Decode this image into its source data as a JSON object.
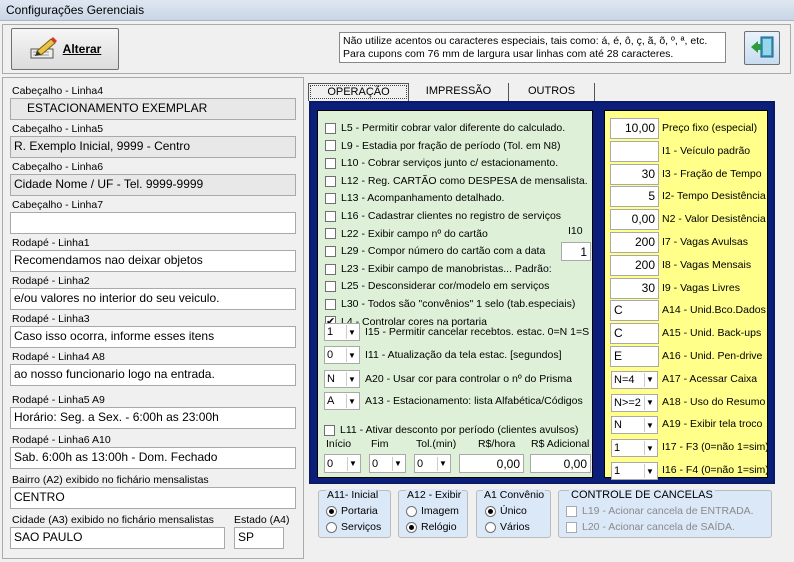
{
  "window": {
    "title": "Configurações Gerenciais"
  },
  "toolbar": {
    "alterar_label": "Alterar",
    "notice_line1": "Não utilize acentos ou caracteres  especiais, tais como: á, é, ô, ç, ã, õ, º, ª, etc.",
    "notice_line2": "Para cupons com 76 mm de largura usar linhas com até 28 caracteres."
  },
  "left": {
    "fields": [
      {
        "label": "Cabeçalho - Linha4",
        "value": "ESTACIONAMENTO EXEMPLAR"
      },
      {
        "label": "Cabeçalho - Linha5",
        "value": "R. Exemplo Inicial, 9999 - Centro"
      },
      {
        "label": "Cabeçalho - Linha6",
        "value": "Cidade Nome / UF - Tel. 9999-9999"
      },
      {
        "label": "Cabeçalho - Linha7",
        "value": ""
      },
      {
        "label": "Rodapé - Linha1",
        "value": "Recomendamos nao deixar objetos"
      },
      {
        "label": "Rodapé - Linha2",
        "value": "e/ou valores no interior do seu veiculo."
      },
      {
        "label": "Rodapé - Linha3",
        "value": "Caso isso ocorra, informe esses itens"
      },
      {
        "label": "Rodapé - Linha4  A8",
        "value": "ao nosso funcionario logo na entrada."
      },
      {
        "label": "Rodapé - Linha5  A9",
        "value": "Horário: Seg. a Sex. -  6:00h as 23:00h"
      },
      {
        "label": "Rodapé - Linha6  A10",
        "value": "Sab. 6:00h as 13:00h  -  Dom. Fechado"
      },
      {
        "label": "Bairro (A2)  exibido no fichário mensalistas",
        "value": "CENTRO"
      }
    ],
    "cidade_label": "Cidade (A3)  exibido no fichário mensalistas",
    "cidade_value": "SAO PAULO",
    "estado_label": "Estado (A4)",
    "estado_value": "SP"
  },
  "tabs": [
    "OPERAÇÃO",
    "IMPRESSÃO",
    "OUTROS"
  ],
  "options": [
    {
      "code": "L5",
      "text": "Permitir cobrar valor diferente do calculado.",
      "checked": false
    },
    {
      "code": "L9",
      "text": "Estadia por fração de período (Tol. em  N8)",
      "checked": false
    },
    {
      "code": "L10",
      "text": "Cobrar serviços junto c/ estacionamento.",
      "checked": false
    },
    {
      "code": "L12",
      "text": "Reg. CARTÃO como DESPESA de mensalista.",
      "checked": false
    },
    {
      "code": "L13",
      "text": "Acompanhamento detalhado.",
      "checked": false
    },
    {
      "code": "L16",
      "text": "Cadastrar clientes no registro de serviços",
      "checked": false
    },
    {
      "code": "L22",
      "text": "Exibir campo nº do cartão",
      "checked": false
    },
    {
      "code": "L29",
      "text": "Compor número do cartão com a data",
      "checked": false
    },
    {
      "code": "L23",
      "text": "Exibir campo de manobristas... Padrão:",
      "checked": false
    },
    {
      "code": "L25",
      "text": "Desconsiderar cor/modelo em serviços",
      "checked": false
    },
    {
      "code": "L30",
      "text": "Todos são \"convênios\" 1 selo (tab.especiais)",
      "checked": false
    },
    {
      "code": "L4",
      "text": "Controlar cores na portaria",
      "checked": true
    }
  ],
  "i10": {
    "label": "I10",
    "value": "1"
  },
  "selects": [
    {
      "value": "1",
      "text": "I15 - Permitir cancelar recebtos. estac. 0=N 1=S"
    },
    {
      "value": "0",
      "text": "I11 - Atualização da tela estac. [segundos]"
    },
    {
      "value": "N",
      "text": "A20 - Usar cor para controlar o nº do Prisma"
    },
    {
      "value": "A",
      "text": "A13 - Estacionamento: lista Alfabética/Códigos"
    }
  ],
  "discount": {
    "text": "L11 - Ativar desconto por período (clientes avulsos)",
    "checked": false,
    "inicio_label": "Início",
    "fim_label": "Fim",
    "tol_label": "Tol.(min)",
    "rhora_label": "R$/hora",
    "radic_label": "R$ Adicional",
    "inicio": "0",
    "fim": "0",
    "tol": "0",
    "rhora": "0,00",
    "radic": "0,00"
  },
  "right": [
    {
      "value": "10,00",
      "label": "Preço fixo (especial)",
      "kind": "num"
    },
    {
      "value": "",
      "label": "I1 - Veículo padrão",
      "kind": "num"
    },
    {
      "value": "30",
      "label": "I3 - Fração de Tempo",
      "kind": "num"
    },
    {
      "value": "5",
      "label": "I2- Tempo Desistência",
      "kind": "num"
    },
    {
      "value": "0,00",
      "label": "N2 - Valor Desistência",
      "kind": "num"
    },
    {
      "value": "200",
      "label": "I7 - Vagas Avulsas",
      "kind": "num"
    },
    {
      "value": "200",
      "label": "I8 - Vagas Mensais",
      "kind": "num"
    },
    {
      "value": "30",
      "label": "I9 - Vagas Livres",
      "kind": "num"
    },
    {
      "value": "C",
      "label": "A14 - Unid.Bco.Dados",
      "kind": "text"
    },
    {
      "value": "C",
      "label": "A15 - Unid. Back-ups",
      "kind": "text"
    },
    {
      "value": "E",
      "label": "A16 - Unid. Pen-drive",
      "kind": "text"
    },
    {
      "value": "N=4",
      "label": "A17 - Acessar Caixa",
      "kind": "sel"
    },
    {
      "value": "N>=2",
      "label": "A18 - Uso do Resumo",
      "kind": "sel"
    },
    {
      "value": "N",
      "label": "A19 - Exibir tela troco",
      "kind": "sel"
    },
    {
      "value": "1",
      "label": "I17 - F3 (0=não 1=sim)",
      "kind": "sel"
    },
    {
      "value": "1",
      "label": "I16 - F4 (0=não 1=sim)",
      "kind": "sel"
    }
  ],
  "groups": {
    "a11": {
      "title": "A11- Inicial",
      "opt1": "Portaria",
      "opt2": "Serviços"
    },
    "a12": {
      "title": "A12 - Exibir",
      "opt1": "Imagem",
      "opt2": "Relógio"
    },
    "a1": {
      "title": "A1 Convênio",
      "opt1": "Único",
      "opt2": "Vários"
    },
    "cancelas": {
      "title": "CONTROLE DE CANCELAS",
      "opt1": "L19 - Acionar cancela de ENTRADA.",
      "opt2": "L20 - Acionar cancela de SAÍDA."
    }
  }
}
